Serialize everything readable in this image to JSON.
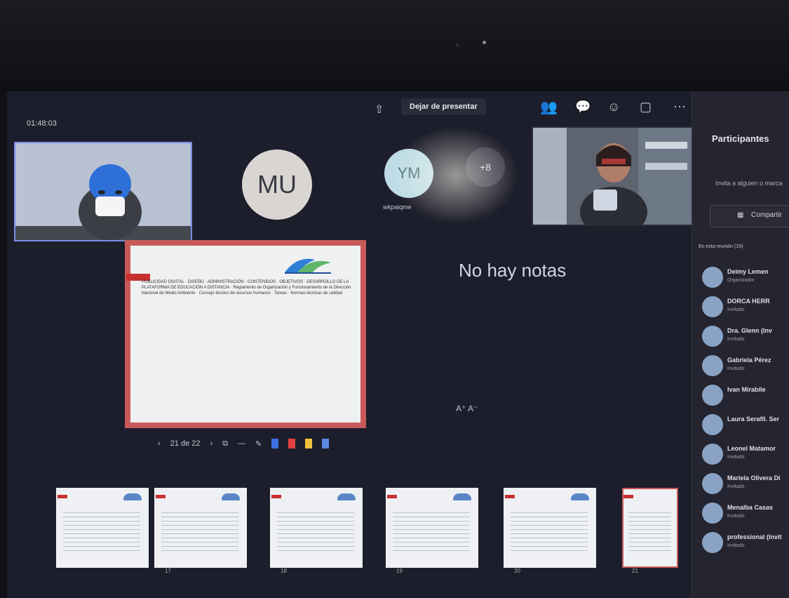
{
  "meeting": {
    "timer": "01:48:03"
  },
  "toolbar": {
    "stop_presenting": "Dejar de presentar"
  },
  "participants_tiles": {
    "mu_initials": "MU",
    "ym_initials": "YM",
    "ym_label": "wkpaiqme",
    "more_label": "+8"
  },
  "presentation": {
    "slide_text": "PUBLICIDAD DIGITAL · DISEÑO · ADMINISTRACIÓN · CONTENIDOS · OBJETIVOS · DESARROLLO DE LA PLATAFORMA DE EDUCACIÓN A DISTANCIA · Reglamento de Organización y Funcionamiento de la Dirección Nacional de Medio Ambiente · Consejo técnico de recursos humanos · Tareas · Normas técnicas de calidad",
    "notes": "No hay notas",
    "font_controls": "A⁺ A⁻",
    "slide_counter": "21 de 22",
    "thumb_numbers": [
      "17",
      "18",
      "19",
      "20",
      "21"
    ]
  },
  "panel": {
    "title": "Participantes",
    "invite": "Invita a alguien o marca",
    "share_label": "Compartir",
    "section": "En esta reunión (15)",
    "people": [
      {
        "name": "Deimy Lemen",
        "role": "Organizador"
      },
      {
        "name": "DORCA HERR",
        "role": "Invitado"
      },
      {
        "name": "Dra. Glenn (Inv",
        "role": "Invitado"
      },
      {
        "name": "Gabriela Pérez",
        "role": "Invitado"
      },
      {
        "name": "Ivan Mirabile",
        "role": ""
      },
      {
        "name": "Laura Serafil. Ser",
        "role": ""
      },
      {
        "name": "Leonel Matamor",
        "role": "Invitado"
      },
      {
        "name": "Mariela Olivera Di",
        "role": "Invitado"
      },
      {
        "name": "Menalba Casas",
        "role": "Invitado"
      },
      {
        "name": "professional (Invit",
        "role": "Invitado"
      }
    ]
  },
  "colors": {
    "accent": "#7b8be8",
    "slide_border": "#c85a5a",
    "panel_bg": "#242530"
  }
}
